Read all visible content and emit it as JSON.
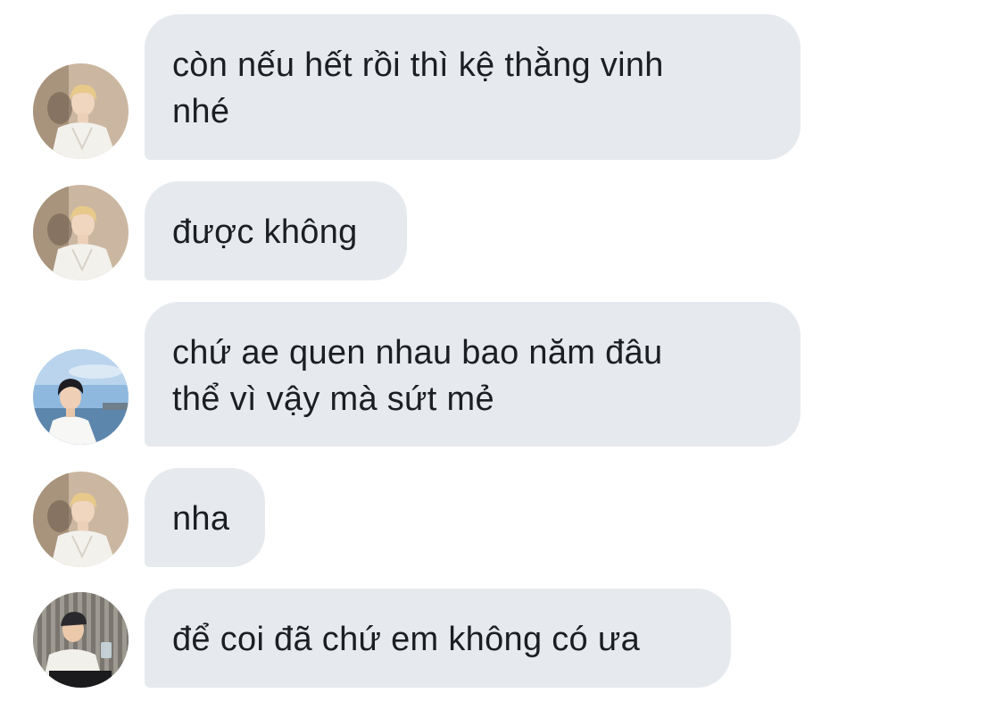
{
  "messages": [
    {
      "avatar": "avatar-blond-white-jacket",
      "lines": [
        "còn nếu hết rồi thì kệ thằng vinh",
        "nhé"
      ]
    },
    {
      "avatar": "avatar-blond-white-jacket",
      "lines": [
        "được không"
      ]
    },
    {
      "avatar": "avatar-dark-hair-seaside",
      "lines": [
        "chứ ae quen nhau bao năm đâu",
        "thể vì vậy mà sứt mẻ"
      ]
    },
    {
      "avatar": "avatar-blond-white-jacket",
      "lines": [
        "nha"
      ]
    },
    {
      "avatar": "avatar-cap-seated-cup",
      "lines": [
        "để coi đã chứ em không có ưa"
      ]
    }
  ],
  "colors": {
    "bubble_bg": "#e6eaee",
    "text": "#1c1e21",
    "background": "#ffffff"
  }
}
